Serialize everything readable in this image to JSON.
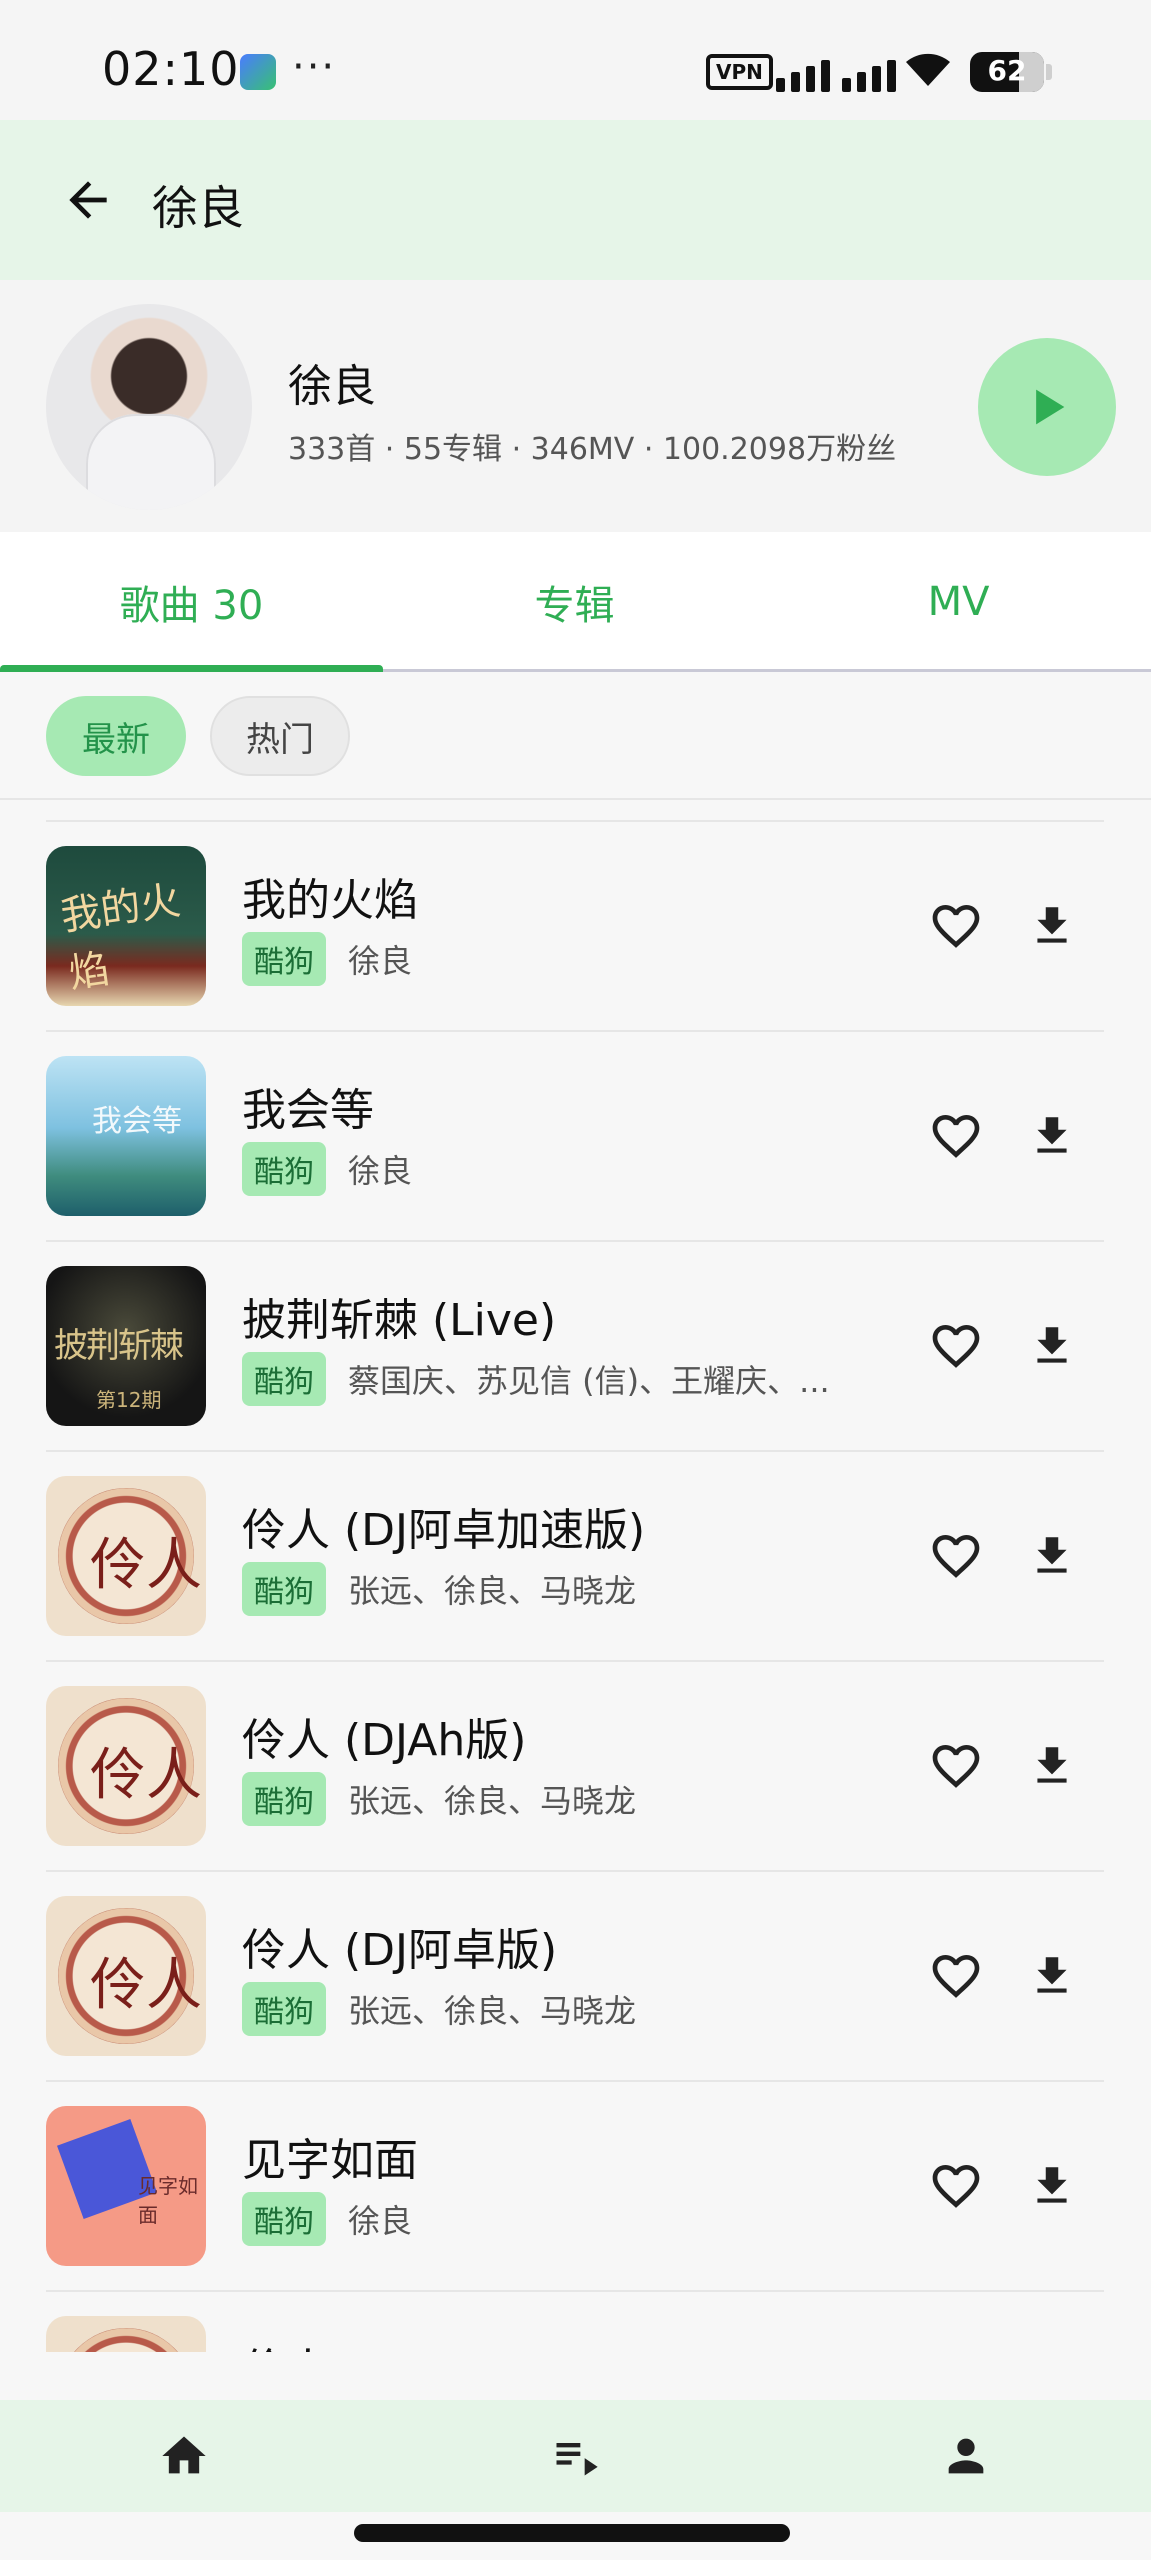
{
  "status_bar": {
    "time": "02:10",
    "dots": "···",
    "vpn": "VPN",
    "battery": "62"
  },
  "app_bar": {
    "title": "徐良",
    "back_icon": "arrow-left-icon"
  },
  "artist": {
    "name": "徐良",
    "stats": "333首 · 55专辑 · 346MV · 100.2098万粉丝"
  },
  "tabs": [
    {
      "label": "歌曲 30",
      "selected": true
    },
    {
      "label": "专辑",
      "selected": false
    },
    {
      "label": "MV",
      "selected": false
    }
  ],
  "chips": [
    {
      "label": "最新",
      "selected": true
    },
    {
      "label": "热门",
      "selected": false
    }
  ],
  "songs": [
    {
      "title": "我的火焰",
      "source": "酷狗",
      "artists": "徐良",
      "cover": "fire"
    },
    {
      "title": "我会等",
      "source": "酷狗",
      "artists": "徐良",
      "cover": "wait"
    },
    {
      "title": "披荆斩棘 (Live)",
      "source": "酷狗",
      "artists": "蔡国庆、苏见信 (信)、王耀庆、...",
      "cover": "thorn"
    },
    {
      "title": "伶人 (DJ阿卓加速版)",
      "source": "酷狗",
      "artists": "张远、徐良、马晓龙",
      "cover": "ling"
    },
    {
      "title": "伶人 (DJAh版)",
      "source": "酷狗",
      "artists": "张远、徐良、马晓龙",
      "cover": "ling"
    },
    {
      "title": "伶人 (DJ阿卓版)",
      "source": "酷狗",
      "artists": "张远、徐良、马晓龙",
      "cover": "ling"
    },
    {
      "title": "见字如面",
      "source": "酷狗",
      "artists": "徐良",
      "cover": "face"
    },
    {
      "title": "伶人",
      "source": "",
      "artists": "",
      "cover": "ling"
    }
  ],
  "cover_art": {
    "fire": "我的火焰",
    "wait": "我会等",
    "thorn_main": "披荆斩棘",
    "thorn_sub": "第12期",
    "ling": "伶人",
    "face": "见字如面"
  },
  "bottom_nav": [
    {
      "icon": "home-icon"
    },
    {
      "icon": "playlist-icon"
    },
    {
      "icon": "person-icon"
    }
  ],
  "colors": {
    "accent": "#2fae54",
    "accent_light": "#a6e9b3",
    "app_bar_bg": "#e6f5e8"
  }
}
